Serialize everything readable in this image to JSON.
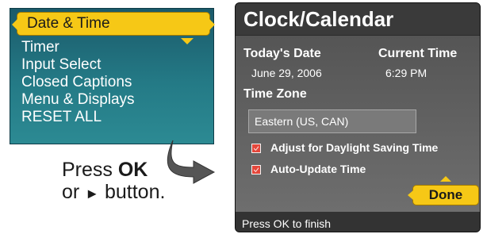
{
  "menu": {
    "items": [
      {
        "label": "Date & Time",
        "selected": true
      },
      {
        "label": "Timer"
      },
      {
        "label": "Input Select"
      },
      {
        "label": "Closed Captions"
      },
      {
        "label": "Menu & Displays"
      },
      {
        "label": "RESET ALL"
      }
    ]
  },
  "instruction": {
    "press": "Press",
    "ok": "OK",
    "or": "or",
    "arrow": "►",
    "button": "button."
  },
  "clock": {
    "title": "Clock/Calendar",
    "todays_date_label": "Today's Date",
    "todays_date_value": "June 29, 2006",
    "current_time_label": "Current Time",
    "current_time_value": "6:29 PM",
    "time_zone_label": "Time Zone",
    "time_zone_value": "Eastern (US, CAN)",
    "options": [
      {
        "label": "Adjust for Daylight Saving Time",
        "checked": true
      },
      {
        "label": "Auto-Update Time",
        "checked": true
      }
    ],
    "done_label": "Done",
    "footer": "Press OK to finish"
  },
  "colors": {
    "menu_bg": "#247a86",
    "highlight": "#f6c816",
    "panel_bg": "#2b2b2b",
    "checkbox": "#e4473b"
  }
}
